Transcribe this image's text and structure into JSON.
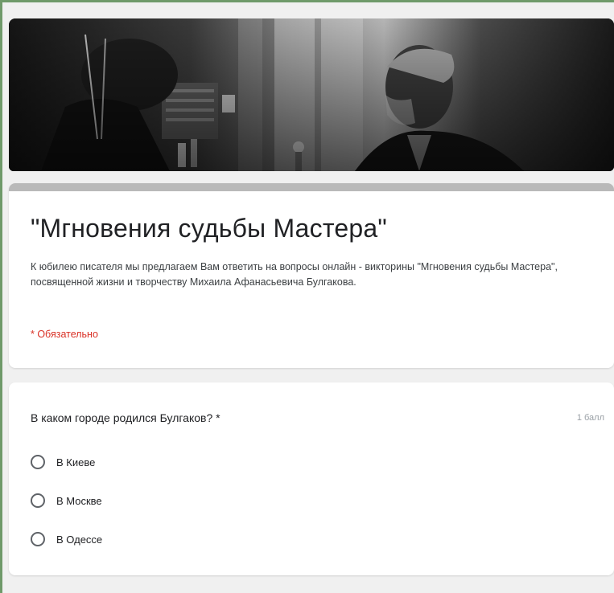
{
  "form": {
    "title": "\"Мгновения судьбы Мастера\"",
    "description": "К юбилею писателя мы предлагаем Вам ответить на вопросы онлайн - викторины \"Мгновения судьбы Мастера\", посвященной жизни и творчеству Михаила Афанасьевича Булгакова.",
    "required_note": "* Обязательно"
  },
  "question": {
    "text": "В каком городе родился Булгаков? *",
    "points": "1 балл",
    "options": [
      {
        "label": "В Киеве"
      },
      {
        "label": "В Москве"
      },
      {
        "label": "В Одессе"
      }
    ]
  },
  "colors": {
    "outer_border": "#6f9a6a",
    "required": "#d93025",
    "title_accent_bar": "#b9b9b9"
  }
}
